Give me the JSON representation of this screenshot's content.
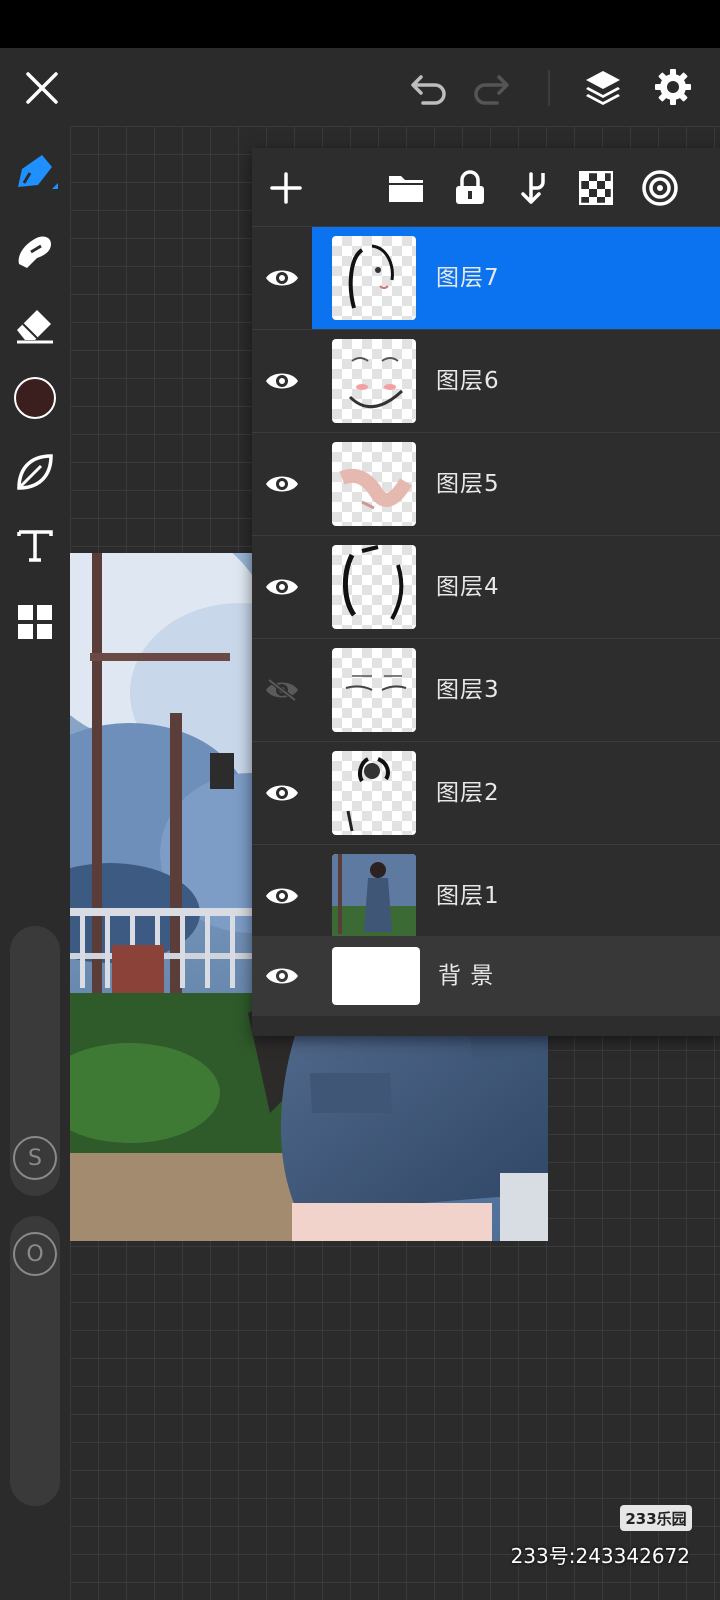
{
  "app": {
    "accent": "#0b73f0",
    "brush_color": "#3b1f1e"
  },
  "topbar": {
    "icons": [
      "close-icon",
      "undo-icon",
      "redo-icon",
      "layers-icon",
      "settings-icon"
    ]
  },
  "toolbar": {
    "tools": [
      "pen-icon",
      "smudge-icon",
      "eraser-icon",
      "color-swatch",
      "leaf-brush-icon",
      "text-icon",
      "grid-icon"
    ],
    "size_slider_label": "S",
    "opacity_slider_label": "O"
  },
  "layers_panel": {
    "toolbar_icons": [
      "add-icon",
      "folder-icon",
      "lock-icon",
      "merge-down-icon",
      "checker-icon",
      "blend-icon"
    ],
    "layers": [
      {
        "name": "图层7",
        "visible": true,
        "selected": true
      },
      {
        "name": "图层6",
        "visible": true,
        "selected": false
      },
      {
        "name": "图层5",
        "visible": true,
        "selected": false
      },
      {
        "name": "图层4",
        "visible": true,
        "selected": false
      },
      {
        "name": "图层3",
        "visible": false,
        "selected": false
      },
      {
        "name": "图层2",
        "visible": true,
        "selected": false
      },
      {
        "name": "图层1",
        "visible": true,
        "selected": false
      }
    ],
    "background_layer": {
      "name": "背 景",
      "visible": true
    }
  },
  "watermark": {
    "logo_text": "233乐园",
    "id_text": "233号:243342672"
  }
}
